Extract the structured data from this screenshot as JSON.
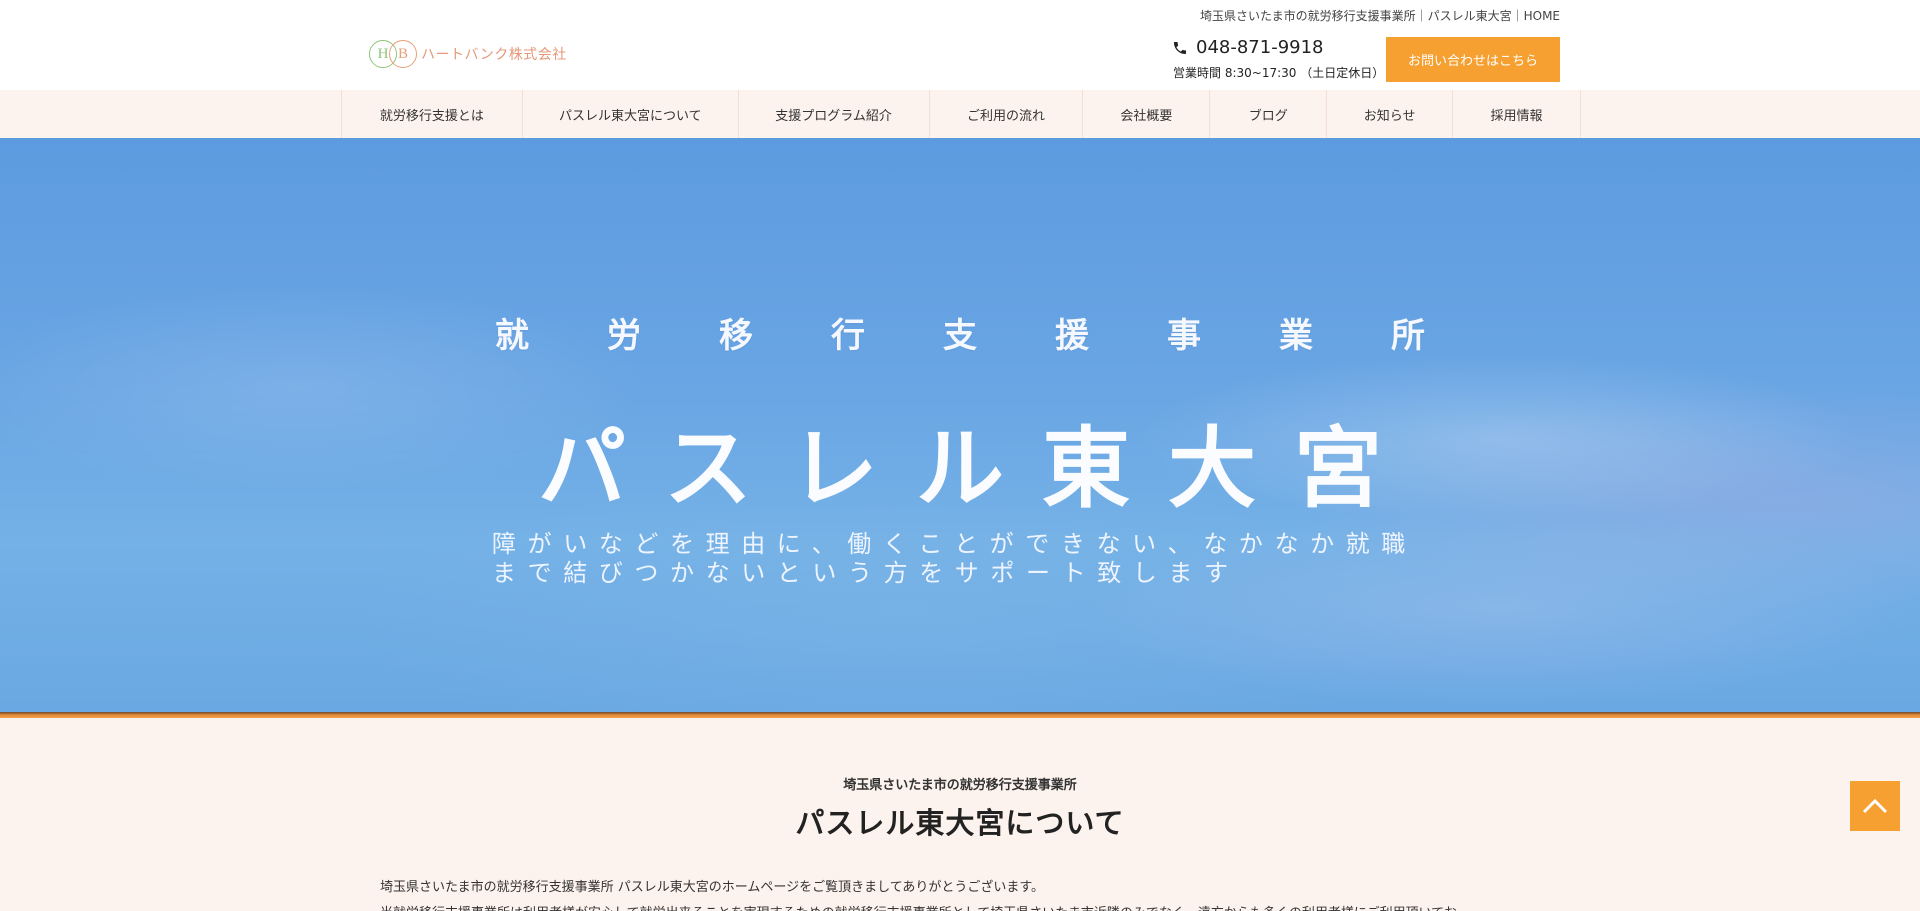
{
  "header": {
    "breadcrumb": "埼玉県さいたま市の就労移行支援事業所｜パスレル東大宮｜HOME",
    "logo_letters": "HB",
    "logo_name": "ハートバンク株式会社",
    "phone": "048-871-9918",
    "hours": "営業時間 8:30~17:30 （土日定休日）",
    "contact_button": "お問い合わせはこちら",
    "accent_color": "#f5a030"
  },
  "nav": {
    "items": [
      {
        "label": "就労移行支援とは"
      },
      {
        "label": "パスレル東大宮について"
      },
      {
        "label": "支援プログラム紹介"
      },
      {
        "label": "ご利用の流れ"
      },
      {
        "label": "会社概要"
      },
      {
        "label": "ブログ"
      },
      {
        "label": "お知らせ"
      },
      {
        "label": "採用情報"
      }
    ]
  },
  "hero": {
    "kicker": "就労移行支援事業所",
    "title": "パスレル東大宮",
    "description": "障がいなどを理由に、働くことができない、なかなか就職まで結びつかないという方をサポート致します"
  },
  "about": {
    "kicker": "埼玉県さいたま市の就労移行支援事業所",
    "title": "パスレル東大宮について",
    "paragraphs": [
      "埼玉県さいたま市の就労移行支援事業所 パスレル東大宮のホームページをご覧頂きましてありがとうございます。",
      "当就労移行支援事業所は利用者様が安心して就労出来ることを実現するための就労移行支援事業所として埼玉県さいたま市近隣のみでなく、遠方からも多くの利用者様にご利用頂いてお"
    ]
  },
  "icons": {
    "phone": "phone-icon",
    "back_to_top": "chevron-up-icon"
  }
}
